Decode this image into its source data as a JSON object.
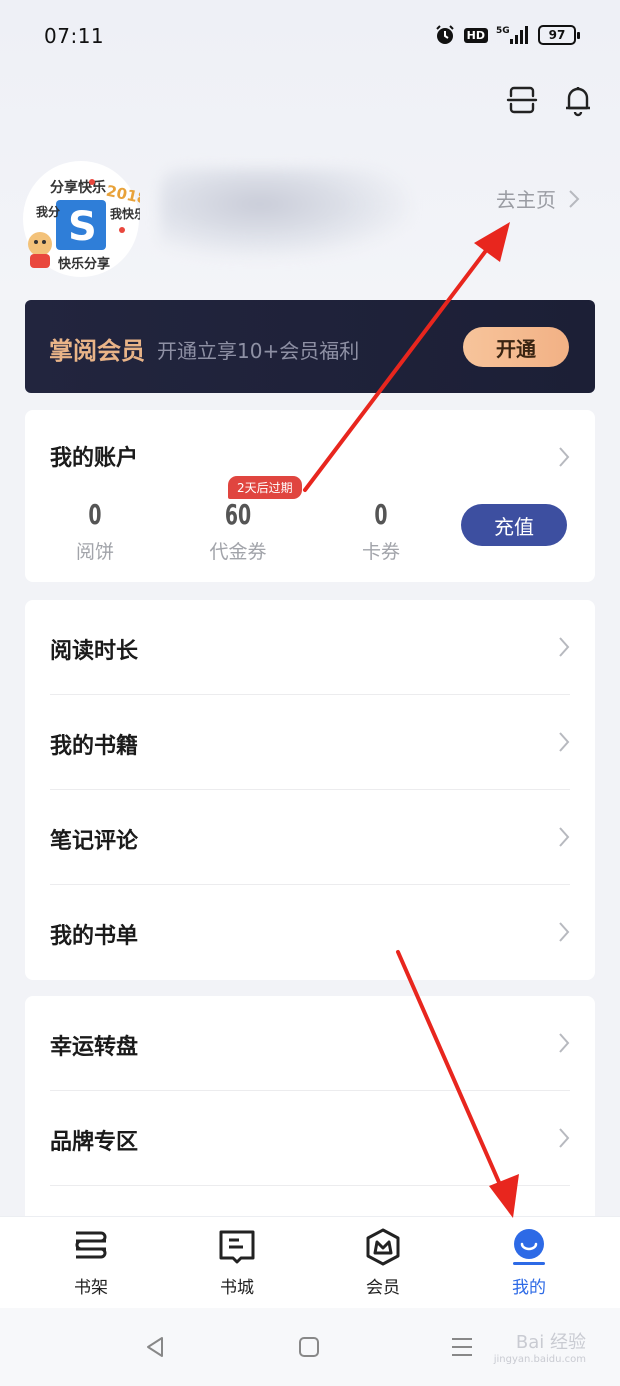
{
  "status_bar": {
    "time": "07:11",
    "network": "5G",
    "hd": "HD",
    "battery": "97"
  },
  "header": {
    "scan_icon": "scan-icon",
    "bell_icon": "bell-icon"
  },
  "profile": {
    "avatar_icon": "sticker-avatar",
    "avatar_text_top": "分享快乐",
    "avatar_text_year": "2018",
    "avatar_text_side_left": "我分",
    "avatar_text_side_right": "我快乐",
    "avatar_text_bottom": "快乐分享",
    "homepage_label": "去主页"
  },
  "vip": {
    "title": "掌阅会员",
    "subtitle": "开通立享10+会员福利",
    "button": "开通",
    "colors": {
      "background": "#1f2239",
      "title": "#e9b488",
      "button": "#f2b185"
    }
  },
  "account": {
    "title": "我的账户",
    "stats": [
      {
        "value": "0",
        "label": "阅饼"
      },
      {
        "value": "60",
        "label": "代金券"
      },
      {
        "value": "0",
        "label": "卡券"
      }
    ],
    "expire_badge": "2天后过期",
    "recharge_button": "充值",
    "colors": {
      "recharge": "#3d4fa0",
      "badge": "#e0453f"
    }
  },
  "menu_group_1": [
    {
      "label": "阅读时长"
    },
    {
      "label": "我的书籍"
    },
    {
      "label": "笔记评论"
    },
    {
      "label": "我的书单"
    }
  ],
  "menu_group_2": [
    {
      "label": "幸运转盘"
    },
    {
      "label": "品牌专区"
    }
  ],
  "bottom_nav": [
    {
      "label": "书架",
      "icon": "bookshelf-icon",
      "active": false
    },
    {
      "label": "书城",
      "icon": "book-store-icon",
      "active": false
    },
    {
      "label": "会员",
      "icon": "vip-crown-icon",
      "active": false
    },
    {
      "label": "我的",
      "icon": "profile-icon",
      "active": true
    }
  ],
  "watermark": {
    "text": "Bai 经验",
    "url": "jingyan.baidu.com"
  },
  "accent_color": "#2d6ae6",
  "annotation_color": "#e8261e"
}
